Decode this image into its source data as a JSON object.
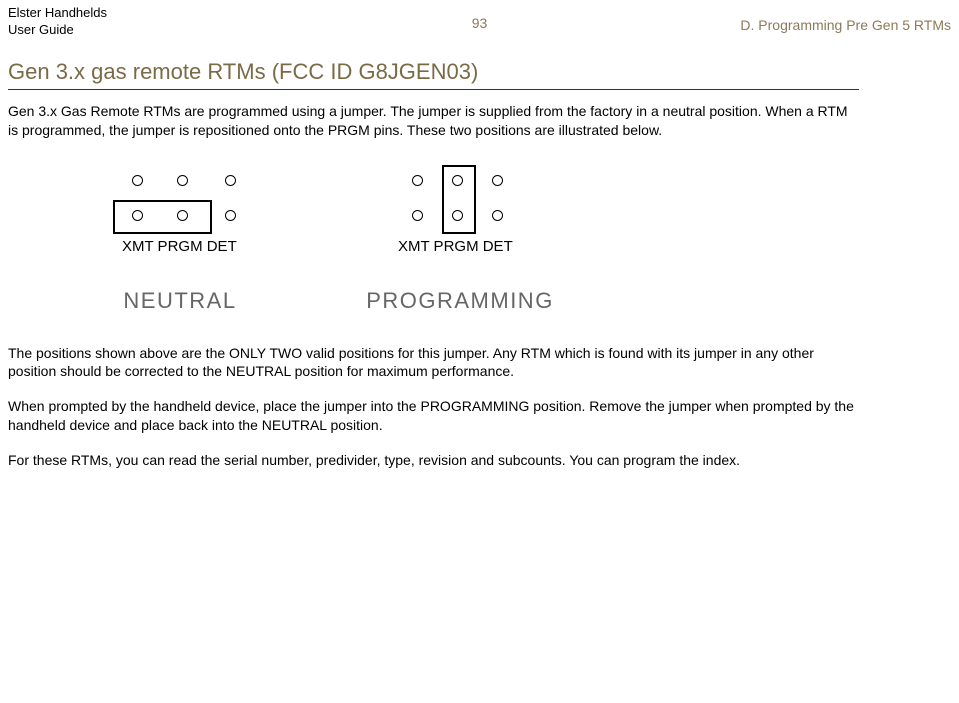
{
  "header": {
    "product_name": "Elster Handhelds",
    "guide_label": "User Guide",
    "page_number": "93",
    "section_label": "D. Programming Pre Gen 5 RTMs"
  },
  "title": "Gen 3.x gas remote RTMs (FCC ID G8JGEN03)",
  "paragraphs": {
    "intro": "Gen 3.x Gas Remote RTMs are programmed using a jumper. The jumper is supplied from the factory in a neutral position. When a RTM is programmed, the jumper is repositioned onto the PRGM pins. These two positions are illustrated below.",
    "positions_note": "The positions shown above are the ONLY TWO valid positions for this jumper. Any RTM which is found with its jumper in any other position should be corrected to the NEUTRAL position for maximum performance.",
    "programming_instruction": "When prompted by the handheld device, place the jumper into the PROGRAMMING position. Remove the jumper when prompted by the handheld device and place back into the NEUTRAL position.",
    "capabilities": "For these RTMs, you can read the serial number, predivider, type, revision and subcounts. You can program the index."
  },
  "diagram": {
    "pin_labels": "XMT PRGM DET",
    "neutral_caption": "NEUTRAL",
    "programming_caption": "PROGRAMMING"
  }
}
